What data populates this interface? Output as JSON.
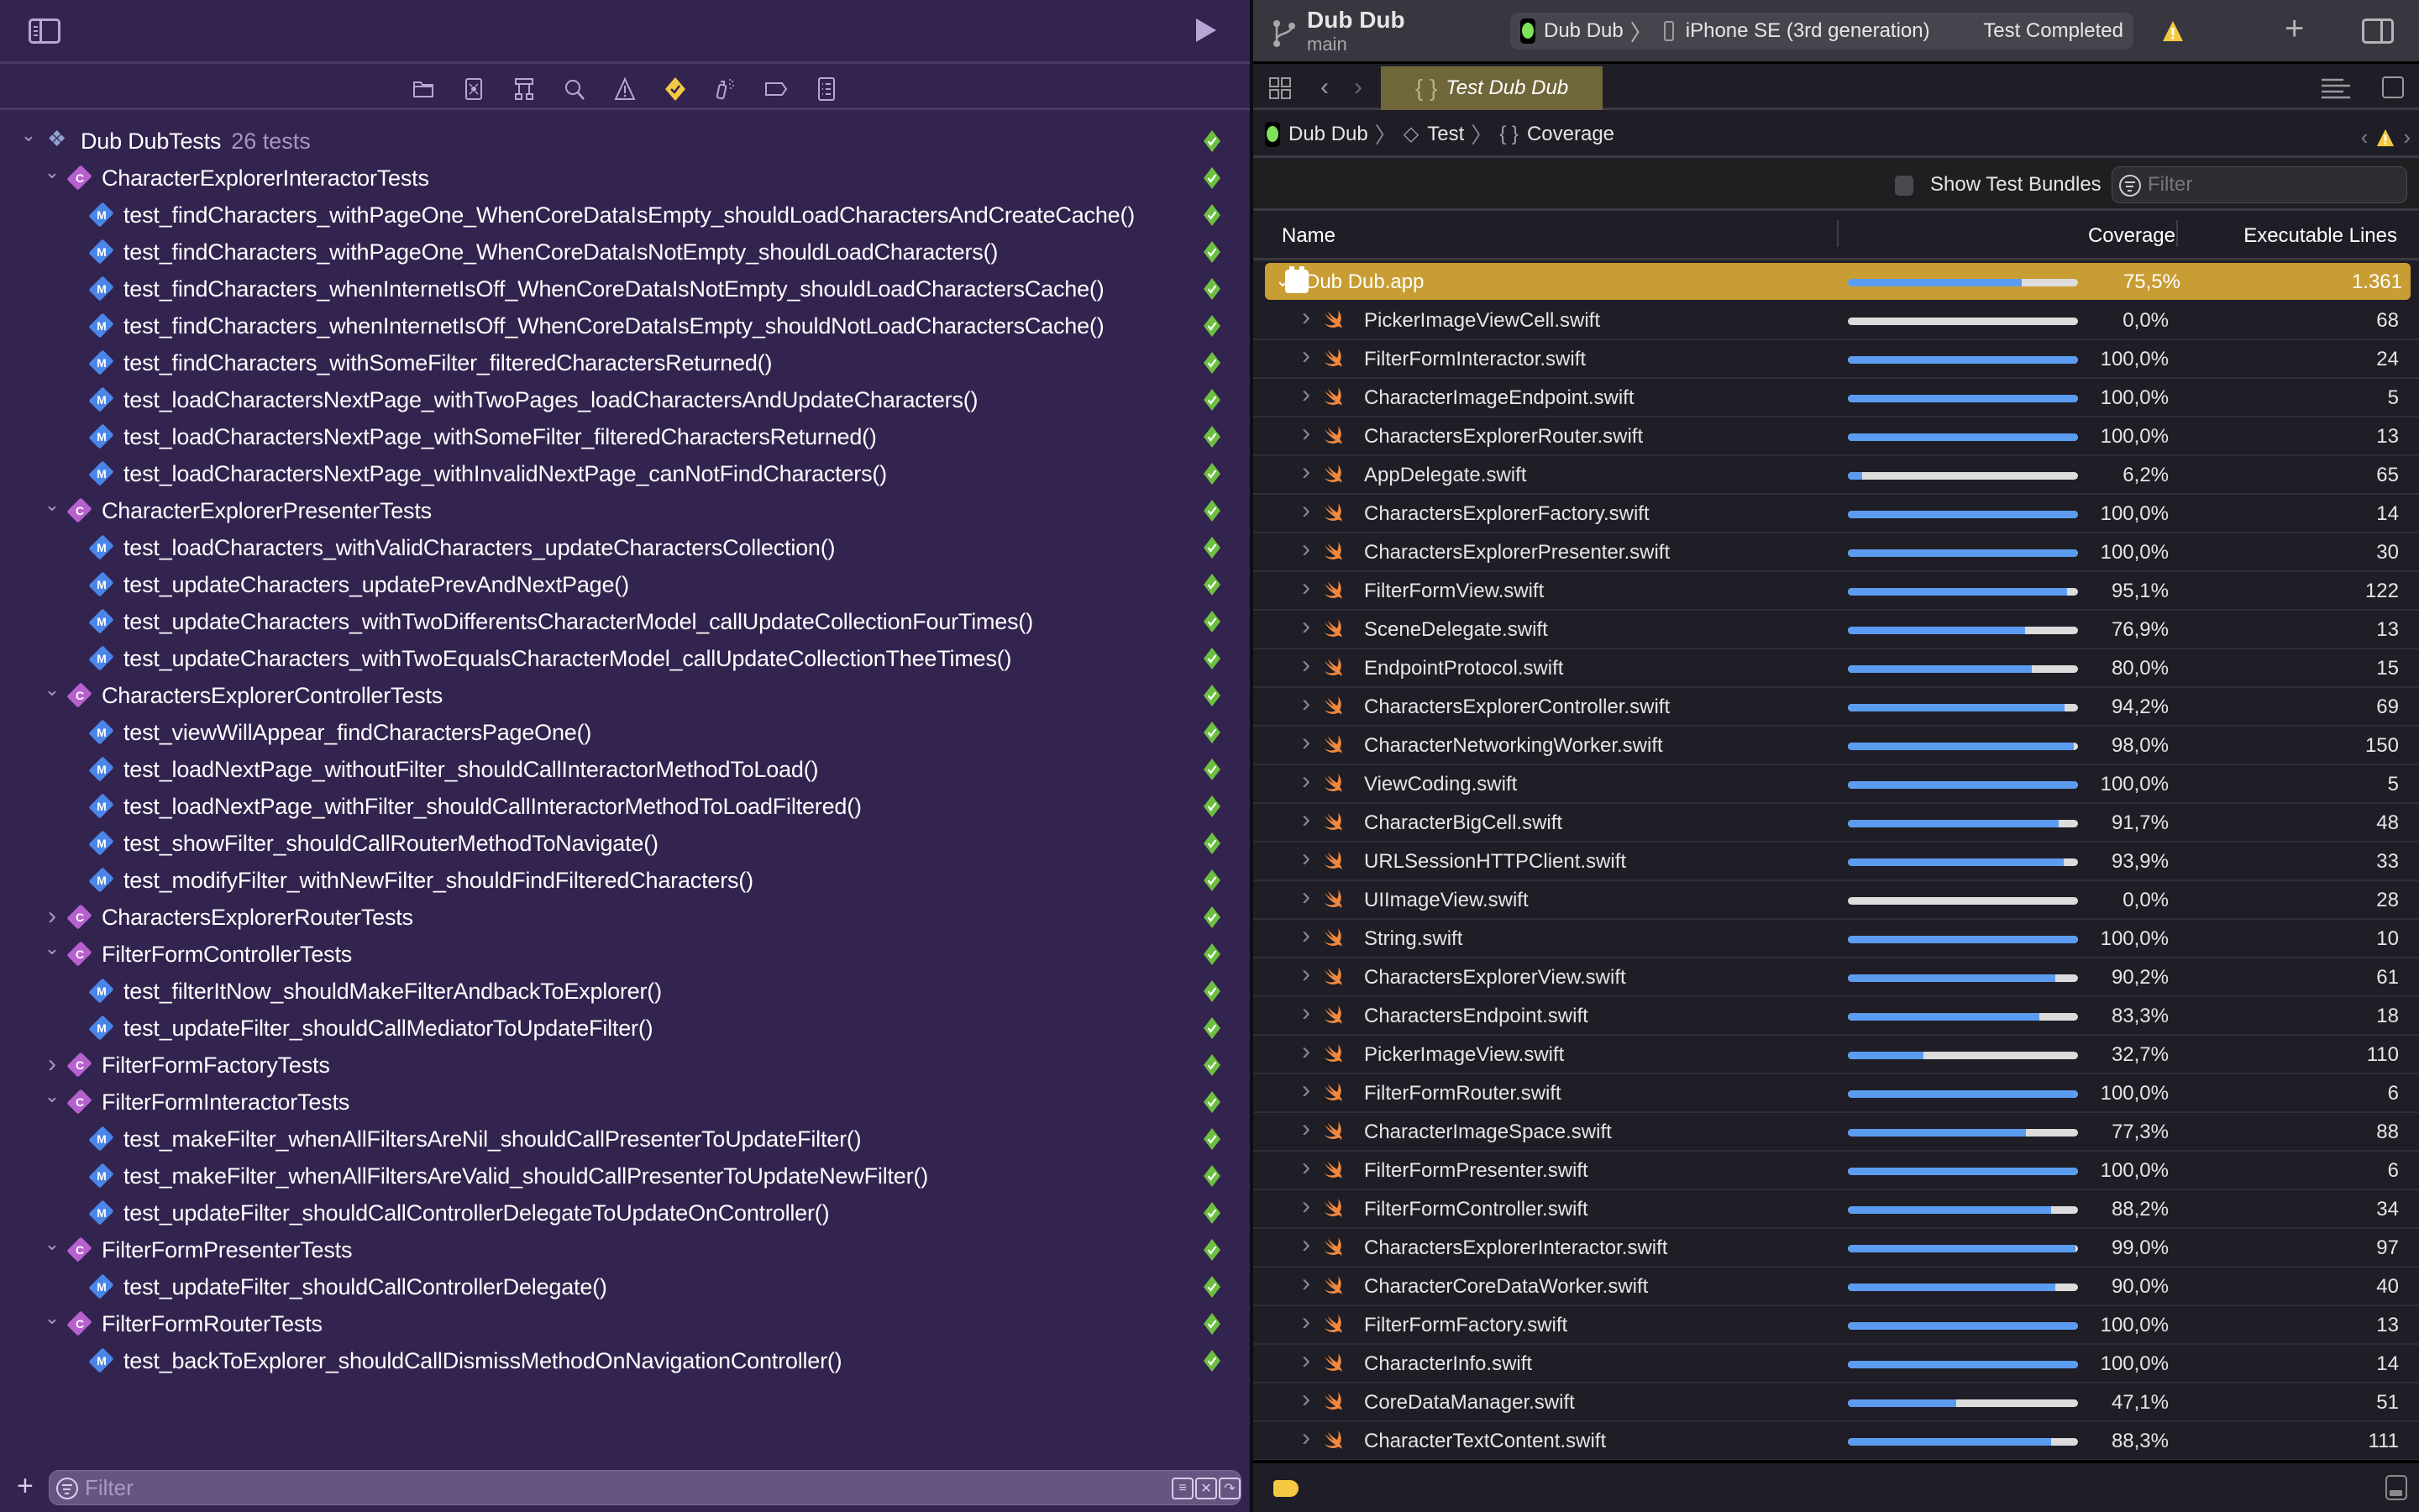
{
  "colors": {
    "navigator_bg": "#33234f",
    "pass_green": "#6cbf3f",
    "class_badge": "#b761cf",
    "method_badge": "#4a86e8",
    "selection_highlight": "#c89d33",
    "coverage_fill": "#5b9cf0",
    "coverage_track": "#dcdcdc",
    "warning_yellow": "#f5c842",
    "active_tab": "#6f663a"
  },
  "navigator": {
    "toolbar_icons": [
      "project-navigator-icon",
      "source-control-icon",
      "symbol-navigator-icon",
      "find-navigator-icon",
      "issue-navigator-icon",
      "test-navigator-icon",
      "debug-navigator-icon",
      "breakpoint-navigator-icon",
      "report-navigator-icon"
    ],
    "active_tab": "test-navigator-icon",
    "root": {
      "label": "Dub DubTests",
      "count": "26 tests",
      "expanded": true,
      "status": "passed"
    },
    "groups": [
      {
        "label": "CharacterExplorerInteractorTests",
        "expanded": true,
        "status": "passed",
        "tests": [
          "test_findCharacters_withPageOne_WhenCoreDataIsEmpty_shouldLoadCharactersAndCreateCache()",
          "test_findCharacters_withPageOne_WhenCoreDataIsNotEmpty_shouldLoadCharacters()",
          "test_findCharacters_whenInternetIsOff_WhenCoreDataIsNotEmpty_shouldLoadCharactersCache()",
          "test_findCharacters_whenInternetIsOff_WhenCoreDataIsEmpty_shouldNotLoadCharactersCache()",
          "test_findCharacters_withSomeFilter_filteredCharactersReturned()",
          "test_loadCharactersNextPage_withTwoPages_loadCharactersAndUpdateCharacters()",
          "test_loadCharactersNextPage_withSomeFilter_filteredCharactersReturned()",
          "test_loadCharactersNextPage_withInvalidNextPage_canNotFindCharacters()"
        ]
      },
      {
        "label": "CharacterExplorerPresenterTests",
        "expanded": true,
        "status": "passed",
        "tests": [
          "test_loadCharacters_withValidCharacters_updateCharactersCollection()",
          "test_updateCharacters_updatePrevAndNextPage()",
          "test_updateCharacters_withTwoDifferentsCharacterModel_callUpdateCollectionFourTimes()",
          "test_updateCharacters_withTwoEqualsCharacterModel_callUpdateCollectionTheeTimes()"
        ]
      },
      {
        "label": "CharactersExplorerControllerTests",
        "expanded": true,
        "status": "passed",
        "tests": [
          "test_viewWillAppear_findCharactersPageOne()",
          "test_loadNextPage_withoutFilter_shouldCallInteractorMethodToLoad()",
          "test_loadNextPage_withFilter_shouldCallInteractorMethodToLoadFiltered()",
          "test_showFilter_shouldCallRouterMethodToNavigate()",
          "test_modifyFilter_withNewFilter_shouldFindFilteredCharacters()"
        ]
      },
      {
        "label": "CharactersExplorerRouterTests",
        "expanded": false,
        "status": "passed",
        "tests": []
      },
      {
        "label": "FilterFormControllerTests",
        "expanded": true,
        "status": "passed",
        "tests": [
          "test_filterItNow_shouldMakeFilterAndbackToExplorer()",
          "test_updateFilter_shouldCallMediatorToUpdateFilter()"
        ]
      },
      {
        "label": "FilterFormFactoryTests",
        "expanded": false,
        "status": "passed",
        "tests": []
      },
      {
        "label": "FilterFormInteractorTests",
        "expanded": true,
        "status": "passed",
        "tests": [
          "test_makeFilter_whenAllFiltersAreNil_shouldCallPresenterToUpdateFilter()",
          "test_makeFilter_whenAllFiltersAreValid_shouldCallPresenterToUpdateNewFilter()",
          "test_updateFilter_shouldCallControllerDelegateToUpdateOnController()"
        ]
      },
      {
        "label": "FilterFormPresenterTests",
        "expanded": true,
        "status": "passed",
        "tests": [
          "test_updateFilter_shouldCallControllerDelegate()"
        ]
      },
      {
        "label": "FilterFormRouterTests",
        "expanded": true,
        "status": "passed",
        "tests": [
          "test_backToExplorer_shouldCallDismissMethodOnNavigationController()"
        ]
      }
    ],
    "filter": {
      "placeholder": "Filter",
      "value": ""
    },
    "badge_class": "C",
    "badge_method": "M"
  },
  "toolbar": {
    "project": "Dub Dub",
    "branch": "main",
    "scheme": "Dub Dub",
    "device": "iPhone SE (3rd generation)",
    "status": "Test Completed"
  },
  "tabs": [
    {
      "label": "Test Dub Dub",
      "active": true
    }
  ],
  "jumpbar": [
    "Dub Dub",
    "Test",
    "Coverage"
  ],
  "coverage": {
    "show_test_bundles_label": "Show Test Bundles",
    "show_test_bundles_checked": false,
    "filter_placeholder": "Filter",
    "columns": {
      "name": "Name",
      "coverage": "Coverage",
      "lines": "Executable Lines"
    },
    "target": {
      "name": "Dub Dub.app",
      "coverage": "75,5%",
      "coverage_fraction": 0.755,
      "lines": "1.361",
      "expanded": true
    },
    "files": [
      {
        "name": "PickerImageViewCell.swift",
        "coverage": "0,0%",
        "fraction": 0.0,
        "lines": "68"
      },
      {
        "name": "FilterFormInteractor.swift",
        "coverage": "100,0%",
        "fraction": 1.0,
        "lines": "24"
      },
      {
        "name": "CharacterImageEndpoint.swift",
        "coverage": "100,0%",
        "fraction": 1.0,
        "lines": "5"
      },
      {
        "name": "CharactersExplorerRouter.swift",
        "coverage": "100,0%",
        "fraction": 1.0,
        "lines": "13"
      },
      {
        "name": "AppDelegate.swift",
        "coverage": "6,2%",
        "fraction": 0.062,
        "lines": "65"
      },
      {
        "name": "CharactersExplorerFactory.swift",
        "coverage": "100,0%",
        "fraction": 1.0,
        "lines": "14"
      },
      {
        "name": "CharactersExplorerPresenter.swift",
        "coverage": "100,0%",
        "fraction": 1.0,
        "lines": "30"
      },
      {
        "name": "FilterFormView.swift",
        "coverage": "95,1%",
        "fraction": 0.951,
        "lines": "122"
      },
      {
        "name": "SceneDelegate.swift",
        "coverage": "76,9%",
        "fraction": 0.769,
        "lines": "13"
      },
      {
        "name": "EndpointProtocol.swift",
        "coverage": "80,0%",
        "fraction": 0.8,
        "lines": "15"
      },
      {
        "name": "CharactersExplorerController.swift",
        "coverage": "94,2%",
        "fraction": 0.942,
        "lines": "69"
      },
      {
        "name": "CharacterNetworkingWorker.swift",
        "coverage": "98,0%",
        "fraction": 0.98,
        "lines": "150"
      },
      {
        "name": "ViewCoding.swift",
        "coverage": "100,0%",
        "fraction": 1.0,
        "lines": "5"
      },
      {
        "name": "CharacterBigCell.swift",
        "coverage": "91,7%",
        "fraction": 0.917,
        "lines": "48"
      },
      {
        "name": "URLSessionHTTPClient.swift",
        "coverage": "93,9%",
        "fraction": 0.939,
        "lines": "33"
      },
      {
        "name": "UIImageView.swift",
        "coverage": "0,0%",
        "fraction": 0.0,
        "lines": "28"
      },
      {
        "name": "String.swift",
        "coverage": "100,0%",
        "fraction": 1.0,
        "lines": "10"
      },
      {
        "name": "CharactersExplorerView.swift",
        "coverage": "90,2%",
        "fraction": 0.902,
        "lines": "61"
      },
      {
        "name": "CharactersEndpoint.swift",
        "coverage": "83,3%",
        "fraction": 0.833,
        "lines": "18"
      },
      {
        "name": "PickerImageView.swift",
        "coverage": "32,7%",
        "fraction": 0.327,
        "lines": "110"
      },
      {
        "name": "FilterFormRouter.swift",
        "coverage": "100,0%",
        "fraction": 1.0,
        "lines": "6"
      },
      {
        "name": "CharacterImageSpace.swift",
        "coverage": "77,3%",
        "fraction": 0.773,
        "lines": "88"
      },
      {
        "name": "FilterFormPresenter.swift",
        "coverage": "100,0%",
        "fraction": 1.0,
        "lines": "6"
      },
      {
        "name": "FilterFormController.swift",
        "coverage": "88,2%",
        "fraction": 0.882,
        "lines": "34"
      },
      {
        "name": "CharactersExplorerInteractor.swift",
        "coverage": "99,0%",
        "fraction": 0.99,
        "lines": "97"
      },
      {
        "name": "CharacterCoreDataWorker.swift",
        "coverage": "90,0%",
        "fraction": 0.9,
        "lines": "40"
      },
      {
        "name": "FilterFormFactory.swift",
        "coverage": "100,0%",
        "fraction": 1.0,
        "lines": "13"
      },
      {
        "name": "CharacterInfo.swift",
        "coverage": "100,0%",
        "fraction": 1.0,
        "lines": "14"
      },
      {
        "name": "CoreDataManager.swift",
        "coverage": "47,1%",
        "fraction": 0.471,
        "lines": "51"
      },
      {
        "name": "CharacterTextContent.swift",
        "coverage": "88,3%",
        "fraction": 0.883,
        "lines": "111"
      }
    ]
  }
}
